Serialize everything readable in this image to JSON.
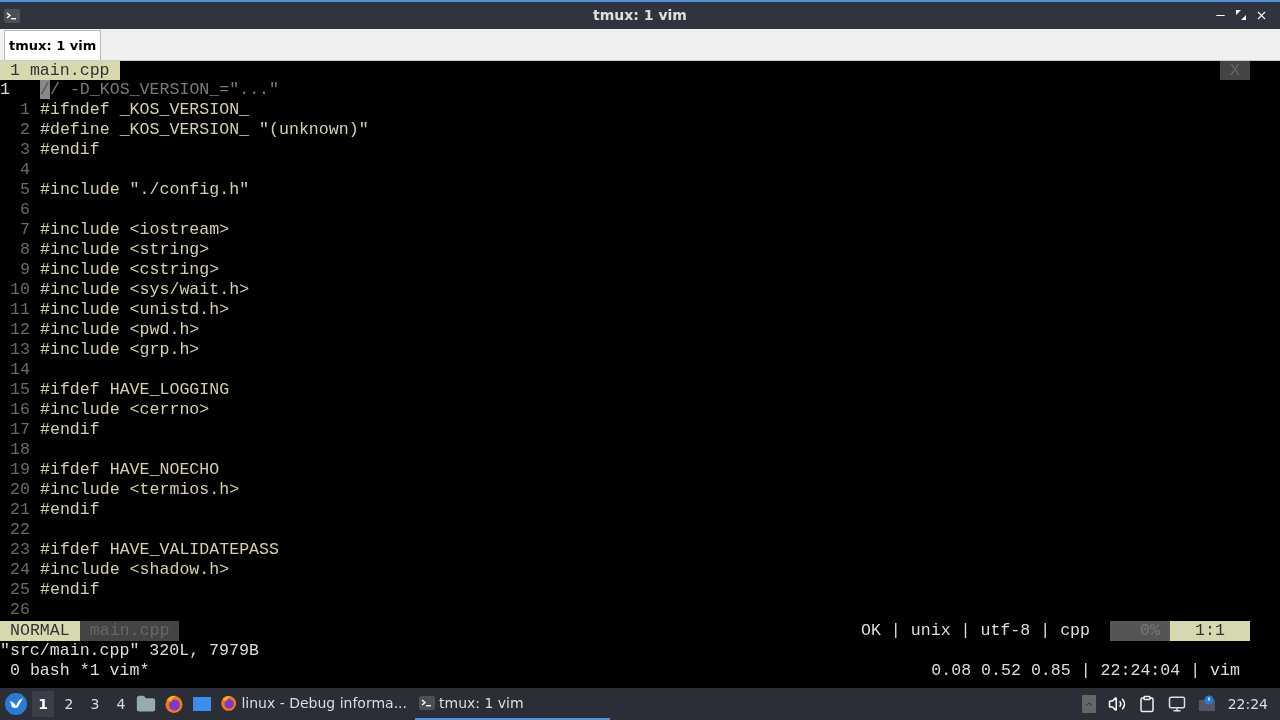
{
  "window": {
    "title": "tmux: 1 vim"
  },
  "tabs": [
    {
      "label": "tmux: 1 vim",
      "selected": true
    }
  ],
  "vim_tabline": {
    "tab": "1 main.cpp",
    "close": "X"
  },
  "lines": [
    {
      "number": "1",
      "text": "// -D_KOS_VERSION_=\"...\"",
      "kind": "comment",
      "current": true
    },
    {
      "number": "1",
      "text": "#ifndef _KOS_VERSION_",
      "kind": "code",
      "current": false
    },
    {
      "number": "2",
      "text": "#define _KOS_VERSION_ \"(unknown)\"",
      "kind": "code",
      "current": false
    },
    {
      "number": "3",
      "text": "#endif",
      "kind": "code",
      "current": false
    },
    {
      "number": "4",
      "current": false
    },
    {
      "number": "5",
      "text": "#include \"./config.h\"",
      "kind": "code",
      "current": false
    },
    {
      "number": "6",
      "current": false
    },
    {
      "number": "7",
      "text": "#include <iostream>",
      "kind": "code",
      "current": false
    },
    {
      "number": "8",
      "text": "#include <string>",
      "kind": "code",
      "current": false
    },
    {
      "number": "9",
      "text": "#include <cstring>",
      "kind": "code",
      "current": false
    },
    {
      "number": "10",
      "text": "#include <sys/wait.h>",
      "kind": "code",
      "current": false
    },
    {
      "number": "11",
      "text": "#include <unistd.h>",
      "kind": "code",
      "current": false
    },
    {
      "number": "12",
      "text": "#include <pwd.h>",
      "kind": "code",
      "current": false
    },
    {
      "number": "13",
      "text": "#include <grp.h>",
      "kind": "code",
      "current": false
    },
    {
      "number": "14",
      "current": false
    },
    {
      "number": "15",
      "text": "#ifdef HAVE_LOGGING",
      "kind": "code",
      "current": false
    },
    {
      "number": "16",
      "text": "#include <cerrno>",
      "kind": "code",
      "current": false
    },
    {
      "number": "17",
      "text": "#endif",
      "kind": "code",
      "current": false
    },
    {
      "number": "18",
      "current": false
    },
    {
      "number": "19",
      "text": "#ifdef HAVE_NOECHO",
      "kind": "code",
      "current": false
    },
    {
      "number": "20",
      "text": "#include <termios.h>",
      "kind": "code",
      "current": false
    },
    {
      "number": "21",
      "text": "#endif",
      "kind": "code",
      "current": false
    },
    {
      "number": "22",
      "current": false
    },
    {
      "number": "23",
      "text": "#ifdef HAVE_VALIDATEPASS",
      "kind": "code",
      "current": false
    },
    {
      "number": "24",
      "text": "#include <shadow.h>",
      "kind": "code",
      "current": false
    },
    {
      "number": "25",
      "text": "#endif",
      "kind": "code",
      "current": false
    },
    {
      "number": "26",
      "current": false
    }
  ],
  "statusline": {
    "mode": "NORMAL",
    "file": "main.cpp",
    "info": "OK | unix | utf-8 | cpp",
    "percent": "0%",
    "position": "1:1"
  },
  "command_line": "\"src/main.cpp\" 320L, 7979B",
  "tmux_status": {
    "windows": "0 bash *1 vim*",
    "right": "0.08 0.52 0.85 | 22:24:04 | vim"
  },
  "taskbar": {
    "workspaces": [
      {
        "label": "1",
        "selected": true
      },
      {
        "label": "2",
        "selected": false
      },
      {
        "label": "3",
        "selected": false
      },
      {
        "label": "4",
        "selected": false
      }
    ],
    "tasks": [
      {
        "label": "linux - Debug informa...",
        "kind": "browser",
        "selected": false
      },
      {
        "label": "tmux: 1 vim",
        "kind": "terminal",
        "selected": true
      }
    ],
    "clock": "22:24"
  }
}
